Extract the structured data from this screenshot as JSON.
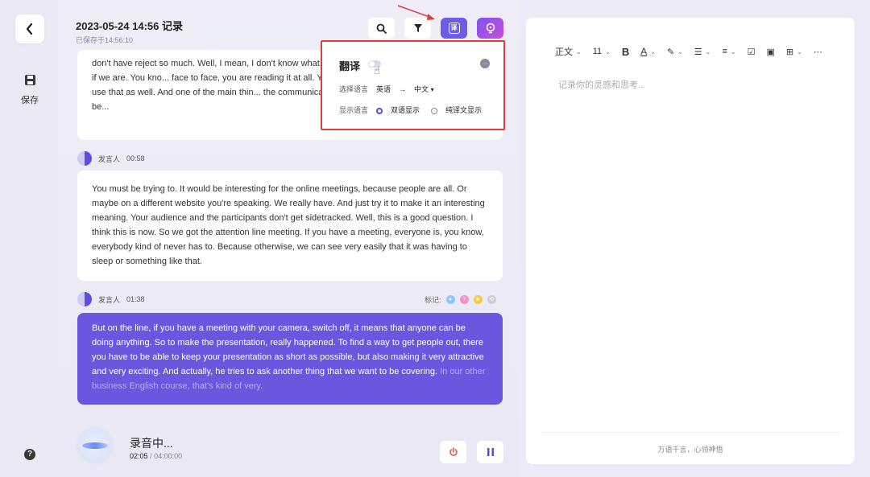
{
  "header": {
    "title": "2023-05-24 14:56 记录",
    "subtitle": "已保存于14:56:10"
  },
  "sidebar": {
    "save_label": "保存",
    "help_glyph": "?"
  },
  "toolbar": {
    "translate_glyph": "译"
  },
  "transcript": [
    {
      "text": "don't have reject so much. Well, I mean, I don't know what... rely so much more in the body language if we are. You kno... face to face, you are reading it at all. Yeah, right. You can... more. And we do use that as well. And one of the main thin... the communication people as well. I think the difference be..."
    },
    {
      "speaker": "发言人",
      "time": "00:58",
      "text": "You must be trying to. It would be interesting for the online meetings, because people are all. Or maybe on a different website you're speaking. We really have. And just try it to make it an interesting meaning. Your audience and the participants don't get sidetracked. Well, this is a good question. I think this is now. So we got the attention line meeting. If you have a meeting, everyone is, you know, everybody kind of never has to. Because otherwise, we can see very easily that it was having to sleep or something like that."
    },
    {
      "speaker": "发言人",
      "time": "01:38",
      "marks_label": "标记:",
      "text": "But on the line, if you have a meeting with your camera, switch off, it means that anyone can be doing anything. So to make the presentation, really happened. To find a way to get people out, there you have to be able to keep your presentation as short as possible, but also making it very attractive and very exciting. And actually, he tries to ask another thing that we want to be covering.",
      "faded_text": "In our other business English course, that's kind of very."
    }
  ],
  "recording": {
    "label": "录音中...",
    "elapsed": "02:05",
    "separator": "/",
    "total": "04:00:00"
  },
  "popover": {
    "title": "翻译",
    "lang_label": "选择语言",
    "source_lang": "英语",
    "arrow": "→",
    "target_lang": "中文",
    "display_label": "显示语言",
    "option_bilingual": "双语显示",
    "option_translation_only": "纯译文显示"
  },
  "editor": {
    "style": "正文",
    "font_size": "11",
    "placeholder": "记录你的灵感和思考...",
    "footer": "万语千言，心领神悟"
  },
  "colors": {
    "accent": "#6957e0",
    "annotation_red": "#e23b3b"
  }
}
